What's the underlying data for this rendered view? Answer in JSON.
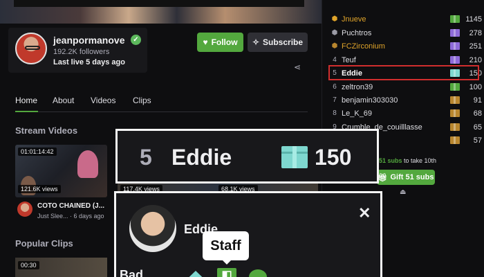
{
  "channel": {
    "name": "jeanpormanove",
    "followers": "192.2K followers",
    "last_live": "Last live 5 days ago",
    "follow_label": "Follow",
    "subscribe_label": "Subscribe"
  },
  "tabs": [
    "Home",
    "About",
    "Videos",
    "Clips"
  ],
  "sections": {
    "stream_videos": "Stream Videos",
    "popular_clips": "Popular Clips"
  },
  "video": {
    "duration": "01:01:14:42",
    "views": "121.6K views",
    "title": "COTO CHAINED (J...",
    "meta": "Just Slee... · 6 days ago",
    "views2": "117.4K views",
    "views3": "68.1K views",
    "clip_duration": "00:30"
  },
  "leaderboard": [
    {
      "rank": "",
      "name": "Jnueve",
      "value": "1145",
      "name_color": "#e0a42a",
      "gift_color": "#53a83e",
      "rank_badge": "gold"
    },
    {
      "rank": "",
      "name": "Puchtros",
      "value": "278",
      "name_color": "#dedee3",
      "gift_color": "#8e6ad8",
      "rank_badge": "silver"
    },
    {
      "rank": "",
      "name": "FCZirconium",
      "value": "251",
      "name_color": "#e0a42a",
      "gift_color": "#8e6ad8",
      "rank_badge": "bronze"
    },
    {
      "rank": "4",
      "name": "Teuf",
      "value": "210",
      "name_color": "#dedee3",
      "gift_color": "#8e6ad8"
    },
    {
      "rank": "5",
      "name": "Eddie",
      "value": "150",
      "name_color": "#ffffff",
      "gift_color": "#7ed7cf"
    },
    {
      "rank": "6",
      "name": "zeltron39",
      "value": "100",
      "name_color": "#dedee3",
      "gift_color": "#53a83e"
    },
    {
      "rank": "7",
      "name": "benjamin303030",
      "value": "91",
      "name_color": "#dedee3",
      "gift_color": "#b8862e"
    },
    {
      "rank": "8",
      "name": "Le_K_69",
      "value": "68",
      "name_color": "#dedee3",
      "gift_color": "#b8862e"
    },
    {
      "rank": "9",
      "name": "Crumble_de_couilllasse",
      "value": "65",
      "name_color": "#dedee3",
      "gift_color": "#b8862e"
    },
    {
      "rank": "",
      "name": "",
      "value": "57",
      "name_color": "#dedee3",
      "gift_color": "#b8862e"
    }
  ],
  "gift": {
    "prompt_count": "51 subs",
    "prompt_text": " to take 10th",
    "button_label": "Gift 51 subs"
  },
  "zoom": {
    "rank": "5",
    "name": "Eddie",
    "value": "150"
  },
  "user_card": {
    "name": "Eddie",
    "tooltip": "Staff",
    "badges_label": "Bad"
  },
  "colors": {
    "accent": "#53a83e",
    "highlight_border": "#d12e2e",
    "gift_teal": "#7ed7cf"
  }
}
